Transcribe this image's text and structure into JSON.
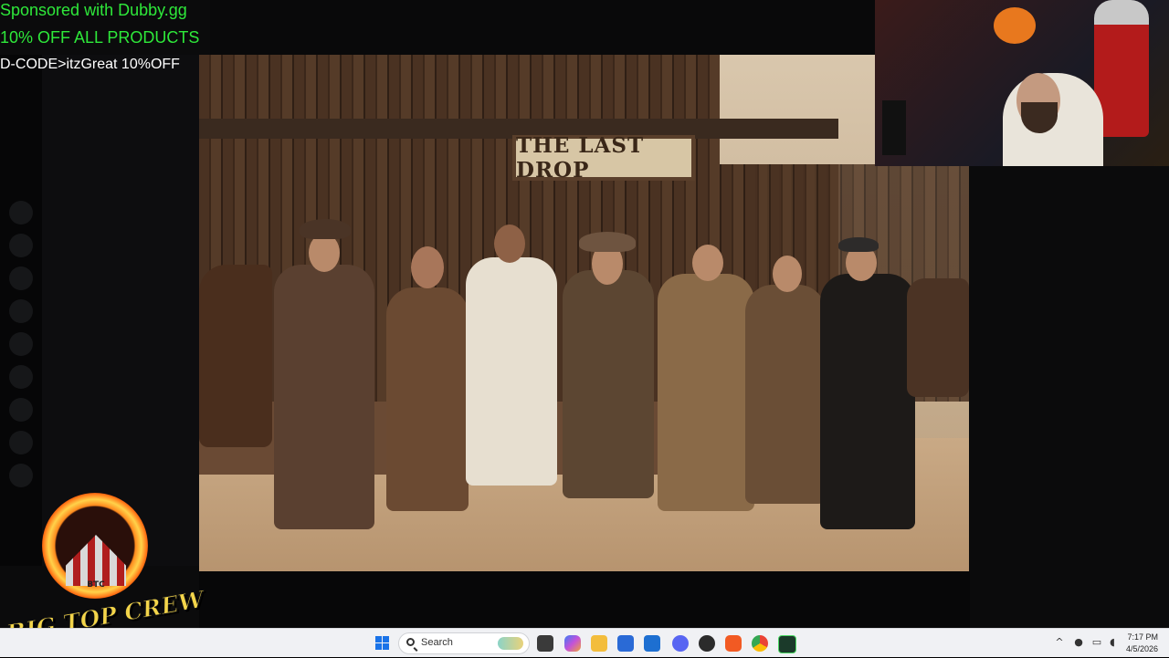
{
  "overlay": {
    "sponsor_line_1": "Sponsored with Dubby.gg",
    "sponsor_line_2": "10% OFF ALL PRODUCTS",
    "sponsor_line_3": "D-CODE>itzGreat 10%OFF"
  },
  "main_image": {
    "sign_text": "THE LAST DROP"
  },
  "logo": {
    "emblem_text": "BTC",
    "banner_text": "BIG TOP CREW"
  },
  "taskbar": {
    "search_placeholder": "Search",
    "apps": [
      "start-icon",
      "search",
      "task-view-icon",
      "copilot-icon",
      "file-explorer-icon",
      "store-icon",
      "outlook-icon",
      "discord-icon",
      "obs-icon",
      "brave-icon",
      "chrome-icon",
      "terminal-icon"
    ],
    "clock_time": "7:17 PM",
    "clock_date": "4/5/2026"
  },
  "colors": {
    "sponsor_green": "#2ee83a",
    "taskbar_bg": "#f0f1f4",
    "logo_gold": "#f3d54a"
  }
}
